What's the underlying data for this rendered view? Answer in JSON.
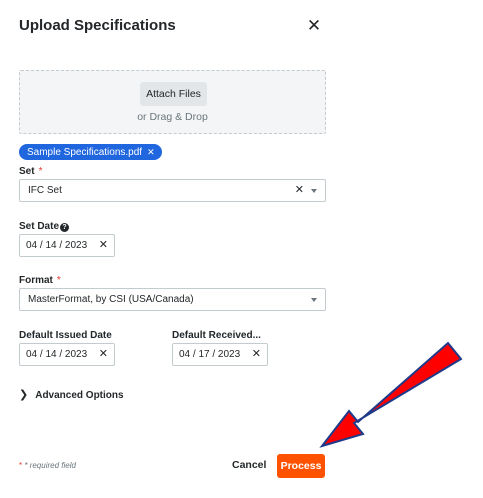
{
  "modal": {
    "title": "Upload Specifications",
    "close_icon": "✕"
  },
  "upload": {
    "attach_label": "Attach Files",
    "drag_text": "or Drag & Drop",
    "file_name": "Sample Specifications.pdf",
    "file_remove_icon": "✕"
  },
  "set": {
    "label": "Set",
    "required_mark": "*",
    "value": "IFC Set",
    "clear_icon": "✕"
  },
  "set_date": {
    "label": "Set Date",
    "help_icon": "?",
    "value": "04  /  14  /  2023",
    "clear_icon": "✕"
  },
  "format": {
    "label": "Format",
    "required_mark": "*",
    "value": "MasterFormat, by CSI (USA/Canada)"
  },
  "default_issued": {
    "label": "Default Issued Date",
    "value": "04  /  14  /  2023",
    "clear_icon": "✕"
  },
  "default_received": {
    "label": "Default Received...",
    "value": "04  /  17  /  2023",
    "clear_icon": "✕"
  },
  "advanced": {
    "label": "Advanced Options",
    "chevron_icon": "❯"
  },
  "footer": {
    "required_star": "*",
    "required_note": " * required field",
    "cancel_label": "Cancel",
    "process_label": "Process"
  },
  "colors": {
    "primary": "#ff5200",
    "chip": "#2066df",
    "required": "#e23a2e",
    "annotation_arrow": "#ff0000",
    "annotation_outline": "#1f3a8a"
  },
  "annotation": {
    "icon": "red-arrow-pointing-at-process"
  }
}
